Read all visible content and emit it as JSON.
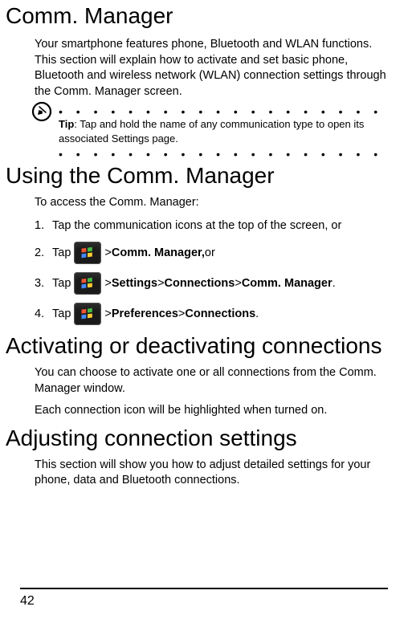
{
  "h1_comm_manager": "Comm. Manager",
  "intro": "Your smartphone features phone, Bluetooth and WLAN functions. This section will explain how to activate and set basic phone, Bluetooth and wireless network (WLAN) connection settings through the Comm. Manager screen.",
  "tip_label": "Tip",
  "tip_text": ": Tap and hold the name of any communication type to open its associated Settings page.",
  "h1_using": "Using the Comm. Manager",
  "access_intro": "To access the Comm. Manager:",
  "steps": {
    "s1": "Tap the communication icons at the top of the screen, or",
    "s2_pre": "Tap ",
    "s2_post_gt": " > ",
    "s2_b": "Comm. Manager,",
    "s2_tail": " or",
    "s3_pre": "Tap ",
    "s3_gt": " > ",
    "s3_b1": "Settings",
    "s3_b2": "Connections",
    "s3_b3": "Comm. Manager",
    "s3_period": ".",
    "s4_pre": "Tap ",
    "s4_gt": " > ",
    "s4_b1": "Preferences",
    "s4_b2": "Connections",
    "s4_period": "."
  },
  "h1_activating": "Activating or deactivating connections",
  "activating_p1": "You can choose to activate one or all connections from the Comm. Manager window.",
  "activating_p2": "Each connection icon will be highlighted when turned on.",
  "h1_adjusting": "Adjusting connection settings",
  "adjusting_p": "This section will show you how to adjust detailed settings for your phone, data and Bluetooth connections.",
  "page_number": "42"
}
